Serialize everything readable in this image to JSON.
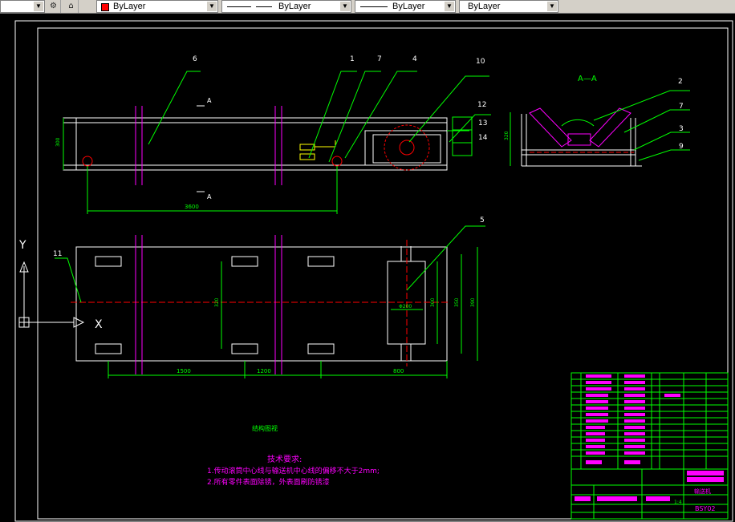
{
  "toolbar": {
    "color_combo": {
      "value": "ByLayer",
      "swatch": "#ff0000"
    },
    "linetype_combo": {
      "value": "ByLayer"
    },
    "lineweight_combo": {
      "value": "ByLayer"
    },
    "plotstyle_combo": {
      "value": "ByLayer"
    }
  },
  "drawing": {
    "section_label": "A—A",
    "section_marker": "A",
    "balloons": [
      "6",
      "1",
      "7",
      "4",
      "10",
      "12",
      "13",
      "14",
      "5",
      "11",
      "2",
      "7",
      "3",
      "9"
    ],
    "dims": {
      "top_height": "300",
      "top_length": "3600",
      "width_inner": "300",
      "width_mid": "350",
      "width_outer": "390",
      "span_vert": "320",
      "pipe_dia": "Φ200",
      "seg1": "1500",
      "seg2": "1200",
      "seg3": "800",
      "side_height": "320"
    },
    "axis_y": "Y",
    "axis_x": "X",
    "note_label": "结构图视",
    "tech_title": "技术要求:",
    "tech_req_1": "1.传动滚筒中心线与输送机中心线的偏移不大于2mm;",
    "tech_req_2": "2.所有零件表面除锈，外表面刷防锈漆",
    "title_block": {
      "drawing_name": "输送机",
      "code": "BSY02",
      "scale": "1:4"
    }
  },
  "colors": {
    "accent_cad_green": "#00ff00",
    "cad_magenta": "#ff00ff",
    "cad_red": "#ff0000",
    "cad_white": "#ffffff",
    "cad_yellow": "#ffff00"
  },
  "icons": [
    "layer-icon",
    "layer-prev-icon",
    "color-swatch-icon",
    "ucs-icon"
  ]
}
